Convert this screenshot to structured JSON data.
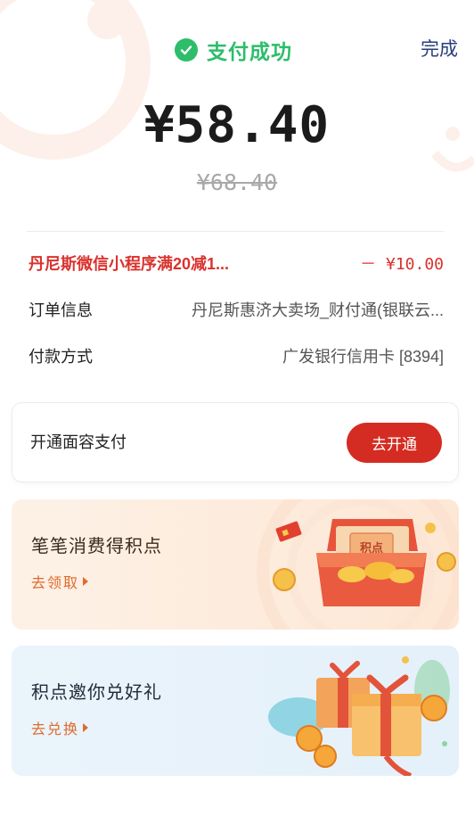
{
  "header": {
    "status_text": "支付成功",
    "done_label": "完成"
  },
  "payment": {
    "amount": "¥58.40",
    "original_amount": "¥68.40"
  },
  "details": {
    "discount": {
      "label": "丹尼斯微信小程序满20减1...",
      "value": "－ ¥10.00"
    },
    "order": {
      "label": "订单信息",
      "value": "丹尼斯惠济大卖场_财付通(银联云..."
    },
    "payment_method": {
      "label": "付款方式",
      "value": "广发银行信用卡 [8394]"
    }
  },
  "face_pay": {
    "label": "开通面容支付",
    "button_label": "去开通"
  },
  "promos": [
    {
      "title": "笔笔消费得积点",
      "link_label": "去领取",
      "art_text": "积点"
    },
    {
      "title": "积点邀你兑好礼",
      "link_label": "去兑换"
    }
  ],
  "colors": {
    "success_green": "#2dbd6b",
    "discount_red": "#d9322d",
    "button_red": "#d42c22",
    "link_orange": "#e06a2c",
    "done_blue": "#2a3f7a"
  },
  "icons": [
    "check-circle-icon",
    "arrow-right-icon",
    "treasure-box-icon",
    "gift-box-icon"
  ]
}
